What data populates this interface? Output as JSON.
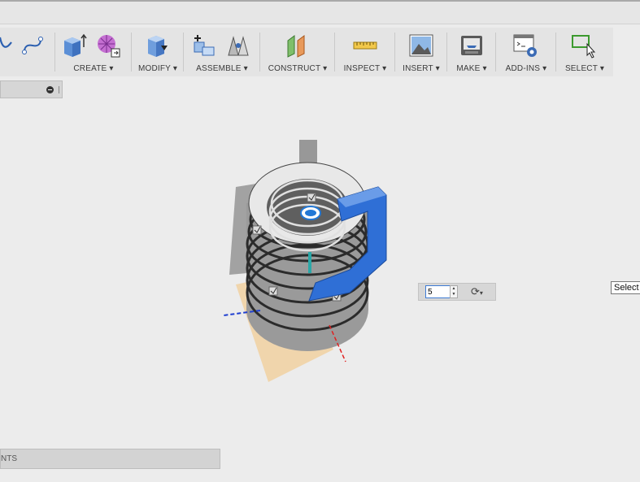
{
  "toolbar": {
    "groups": [
      {
        "label": ""
      },
      {
        "label": "CREATE ▾"
      },
      {
        "label": "MODIFY ▾"
      },
      {
        "label": "ASSEMBLE ▾"
      },
      {
        "label": "CONSTRUCT ▾"
      },
      {
        "label": "INSPECT ▾"
      },
      {
        "label": "INSERT ▾"
      },
      {
        "label": "MAKE ▾"
      },
      {
        "label": "ADD-INS ▾"
      },
      {
        "label": "SELECT ▾"
      }
    ]
  },
  "comments": {
    "label": "NTS"
  },
  "pattern_quantity": {
    "value": "5"
  },
  "tooltip": {
    "text": "Select"
  },
  "colors": {
    "selected_body": "#2f6fd6",
    "construction_plane": "#f3c98a",
    "model_grey": "#8a8a8a"
  }
}
